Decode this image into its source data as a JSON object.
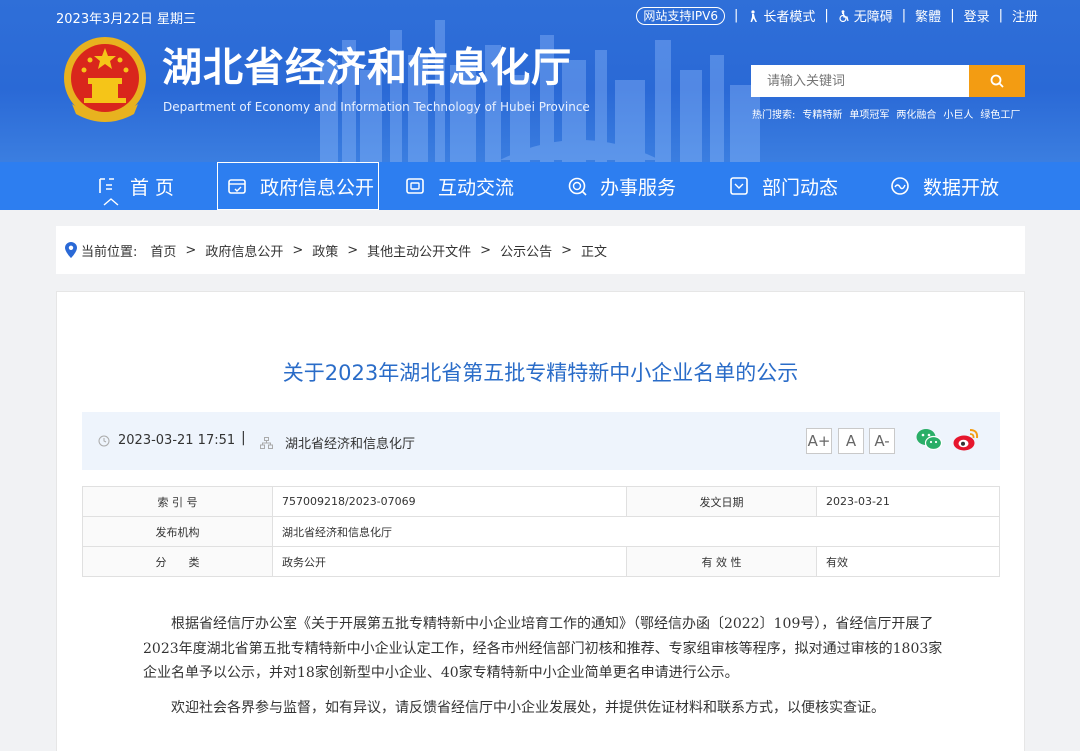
{
  "header": {
    "date": "2023年3月22日 星期三",
    "ipv6": "网站支持IPV6",
    "elder_mode": "长者模式",
    "accessibility": "无障碍",
    "traditional": "繁體",
    "login": "登录",
    "register": "注册",
    "site_title": "湖北省经济和信息化厅",
    "site_subtitle": "Department of Economy and Information Technology of Hubei Province",
    "search_placeholder": "请输入关键词",
    "hot_label": "热门搜索:",
    "hot_terms": [
      "专精特新",
      "单项冠军",
      "两化融合",
      "小巨人",
      "绿色工厂"
    ]
  },
  "nav": {
    "items": [
      {
        "label": "首 页",
        "icon": "home-icon"
      },
      {
        "label": "政府信息公开",
        "icon": "gov-info-icon"
      },
      {
        "label": "互动交流",
        "icon": "chat-icon"
      },
      {
        "label": "办事服务",
        "icon": "service-icon"
      },
      {
        "label": "部门动态",
        "icon": "news-icon"
      },
      {
        "label": "数据开放",
        "icon": "data-icon"
      }
    ],
    "active_index": 1
  },
  "breadcrumb": {
    "prefix": "当前位置:",
    "items": [
      "首页",
      "政府信息公开",
      "政策",
      "其他主动公开文件",
      "公示公告",
      "正文"
    ]
  },
  "article": {
    "title": "关于2023年湖北省第五批专精特新中小企业名单的公示",
    "publish_time": "2023-03-21 17:51",
    "source": "湖北省经济和信息化厅",
    "font_sizes": [
      "A+",
      "A",
      "A-"
    ],
    "info_table": {
      "index_label": "索 引 号",
      "index_value": "757009218/2023-07069",
      "date_label": "发文日期",
      "date_value": "2023-03-21",
      "org_label": "发布机构",
      "org_value": "湖北省经济和信息化厅",
      "category_label": "分　　类",
      "category_value": "政务公开",
      "validity_label": "有 效 性",
      "validity_value": "有效"
    },
    "paragraphs": [
      "根据省经信厅办公室《关于开展第五批专精特新中小企业培育工作的通知》（鄂经信办函〔2022〕109号），省经信厅开展了2023年度湖北省第五批专精特新中小企业认定工作，经各市州经信部门初核和推荐、专家组审核等程序，拟对通过审核的1803家企业名单予以公示，并对18家创新型中小企业、40家专精特新中小企业简单更名申请进行公示。",
      "欢迎社会各界参与监督，如有异议，请反馈省经信厅中小企业发展处，并提供佐证材料和联系方式，以便核实查证。"
    ]
  },
  "colors": {
    "header_blue": "#2a69d6",
    "nav_blue": "#2d7ef0",
    "title_blue": "#2a6cc8",
    "search_orange": "#f39c12",
    "wechat_green": "#2aae67",
    "weibo_red": "#e6162d"
  }
}
